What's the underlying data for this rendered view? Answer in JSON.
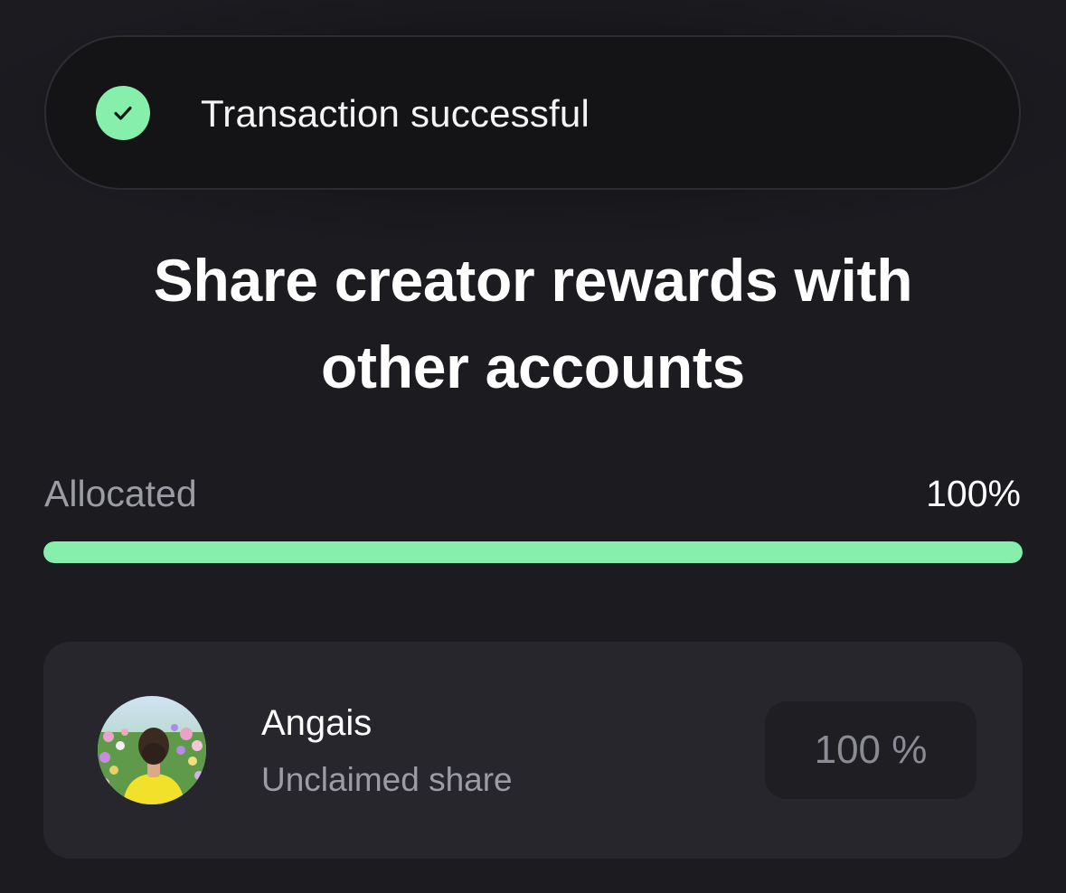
{
  "toast": {
    "icon": "check-icon",
    "message": "Transaction successful",
    "status_color": "#86efac"
  },
  "heading": {
    "line1": "Share creator rewards with",
    "line2": "other accounts"
  },
  "allocation": {
    "label": "Allocated",
    "value_text": "100%",
    "percent": 100,
    "bar_color": "#86efac"
  },
  "accounts": [
    {
      "name": "Angais",
      "subtitle": "Unclaimed share",
      "share_value": "100 %",
      "avatar_icon": "avatar-photo"
    }
  ],
  "colors": {
    "background": "#1b1b20",
    "card": "#26262c",
    "accent": "#86efac"
  }
}
